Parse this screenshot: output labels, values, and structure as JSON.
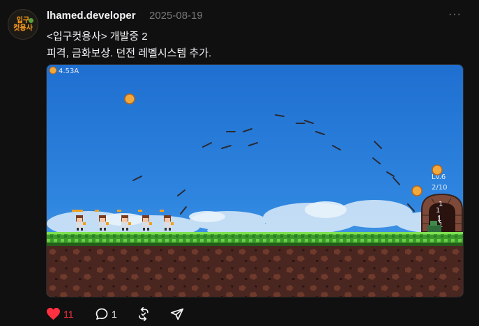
{
  "post": {
    "avatar_text": [
      "입구",
      "컷용사"
    ],
    "username": "lhamed.developer",
    "date": "2025-08-19",
    "more_label": "···",
    "title_line": "<입구컷용사> 개발중 2",
    "body_line": "피격, 금화보상. 던전 레벨시스템 추가."
  },
  "game": {
    "gold_value": "4.53A",
    "boss_level": "Lv.6",
    "boss_hp": "2/10",
    "hit_numbers": [
      "1",
      "1",
      "1",
      "1"
    ]
  },
  "actions": {
    "like_count": "11",
    "reply_count": "1",
    "liked": true,
    "like_color": "#ff3040"
  },
  "icons": [
    "heart-icon",
    "comment-icon",
    "repost-icon",
    "share-icon",
    "more-icon",
    "coin-icon"
  ]
}
